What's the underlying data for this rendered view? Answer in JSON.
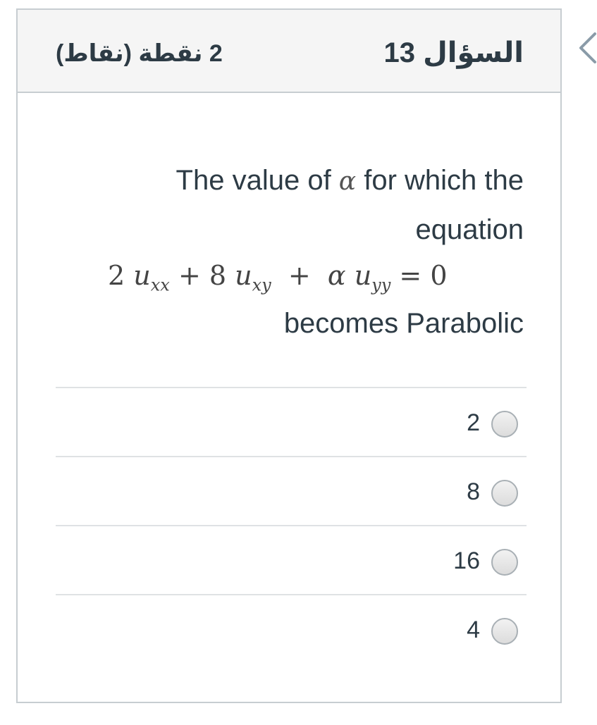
{
  "header": {
    "question_title": "السؤال 13",
    "points": "2 نقطة (نقاط)"
  },
  "question": {
    "text_before_alpha": "The value of ",
    "alpha_symbol": "α",
    "text_after_alpha": " for which the equation",
    "equation": {
      "c1": "2",
      "u": "u",
      "sub1": "xx",
      "plus": "+",
      "c2": "8",
      "sub2": "xy",
      "alpha": "α",
      "sub3": "yy",
      "equals": "=",
      "rhs": "0"
    },
    "text_end": "becomes Parabolic"
  },
  "answers": [
    {
      "label": "2"
    },
    {
      "label": "8"
    },
    {
      "label": "16"
    },
    {
      "label": "4"
    }
  ],
  "icons": {
    "nav": "chevron-left-icon",
    "radio": "radio-unchecked-icon"
  },
  "colors": {
    "header_bg": "#f5f5f5",
    "border": "#c7cdd1",
    "text": "#2d3b45"
  }
}
